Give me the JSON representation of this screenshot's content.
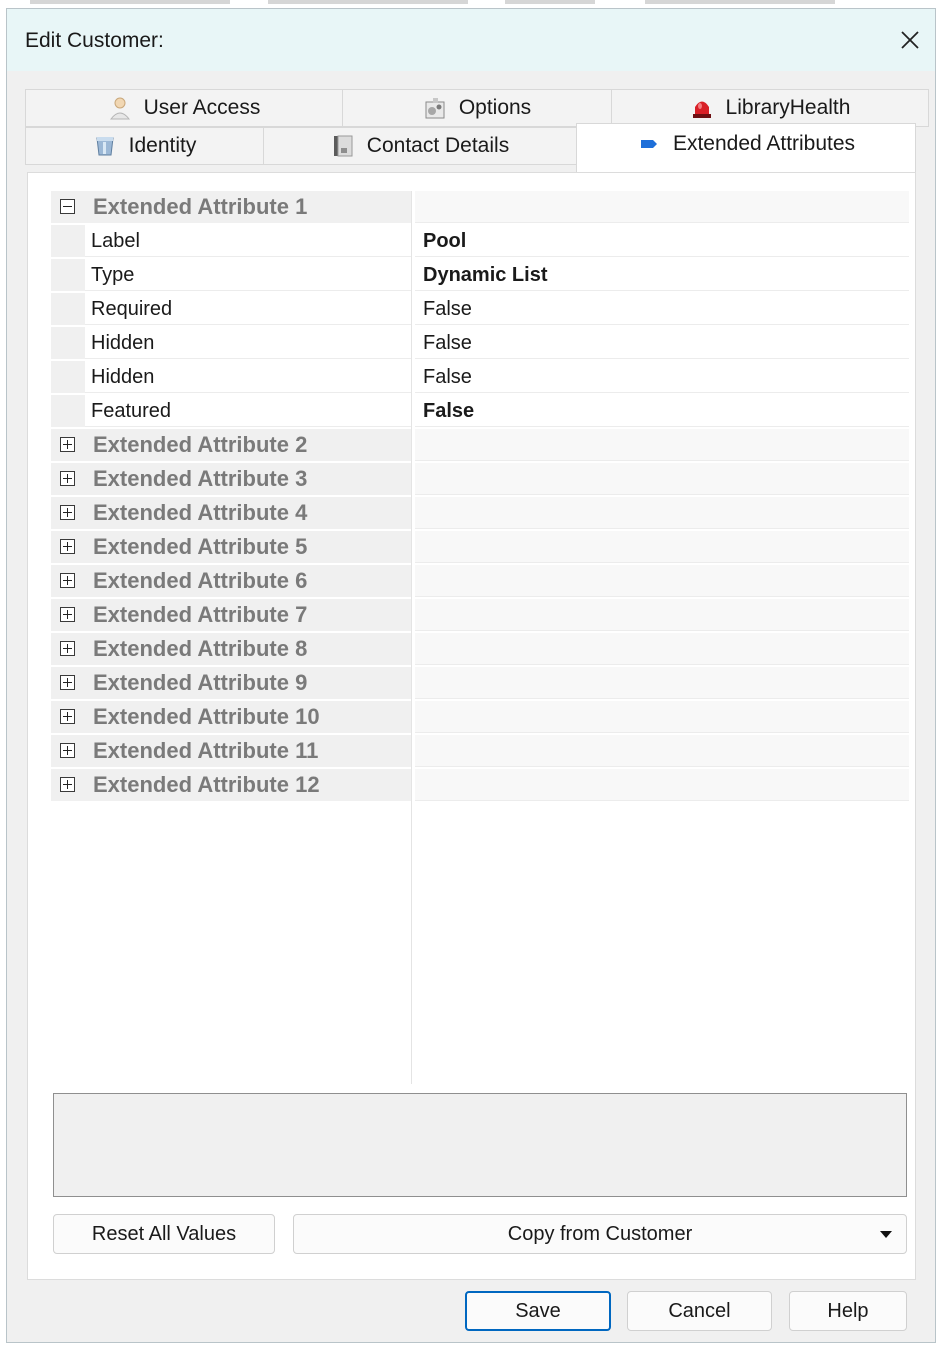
{
  "window": {
    "title": "Edit Customer:"
  },
  "tabs": {
    "row1": [
      {
        "label": "User Access",
        "icon": "user-icon"
      },
      {
        "label": "Options",
        "icon": "options-icon"
      },
      {
        "label": "LibraryHealth",
        "icon": "alarm-icon"
      }
    ],
    "row2": [
      {
        "label": "Identity",
        "icon": "identity-icon"
      },
      {
        "label": "Contact Details",
        "icon": "contact-book-icon"
      },
      {
        "label": "Extended Attributes",
        "icon": "tag-icon",
        "active": true
      }
    ]
  },
  "property_grid": {
    "expanded_category": {
      "label": "Extended Attribute 1",
      "properties": [
        {
          "name": "Label",
          "value": "Pool",
          "bold": true
        },
        {
          "name": "Type",
          "value": "Dynamic List",
          "bold": true
        },
        {
          "name": "Required",
          "value": "False",
          "bold": false
        },
        {
          "name": "Hidden",
          "value": "False",
          "bold": false
        },
        {
          "name": "Hidden",
          "value": "False",
          "bold": false
        },
        {
          "name": "Featured",
          "value": "False",
          "bold": true
        }
      ]
    },
    "collapsed_categories": [
      "Extended Attribute 2",
      "Extended Attribute 3",
      "Extended Attribute 4",
      "Extended Attribute 5",
      "Extended Attribute 6",
      "Extended Attribute 7",
      "Extended Attribute 8",
      "Extended Attribute 9",
      "Extended Attribute 10",
      "Extended Attribute 11",
      "Extended Attribute 12"
    ]
  },
  "actions": {
    "reset_label": "Reset All Values",
    "copy_label": "Copy from Customer"
  },
  "footer": {
    "save_label": "Save",
    "cancel_label": "Cancel",
    "help_label": "Help"
  },
  "colors": {
    "titlebar": "#e8f6f7",
    "primary_border": "#0067c0",
    "category_text": "#7a7a7a"
  }
}
